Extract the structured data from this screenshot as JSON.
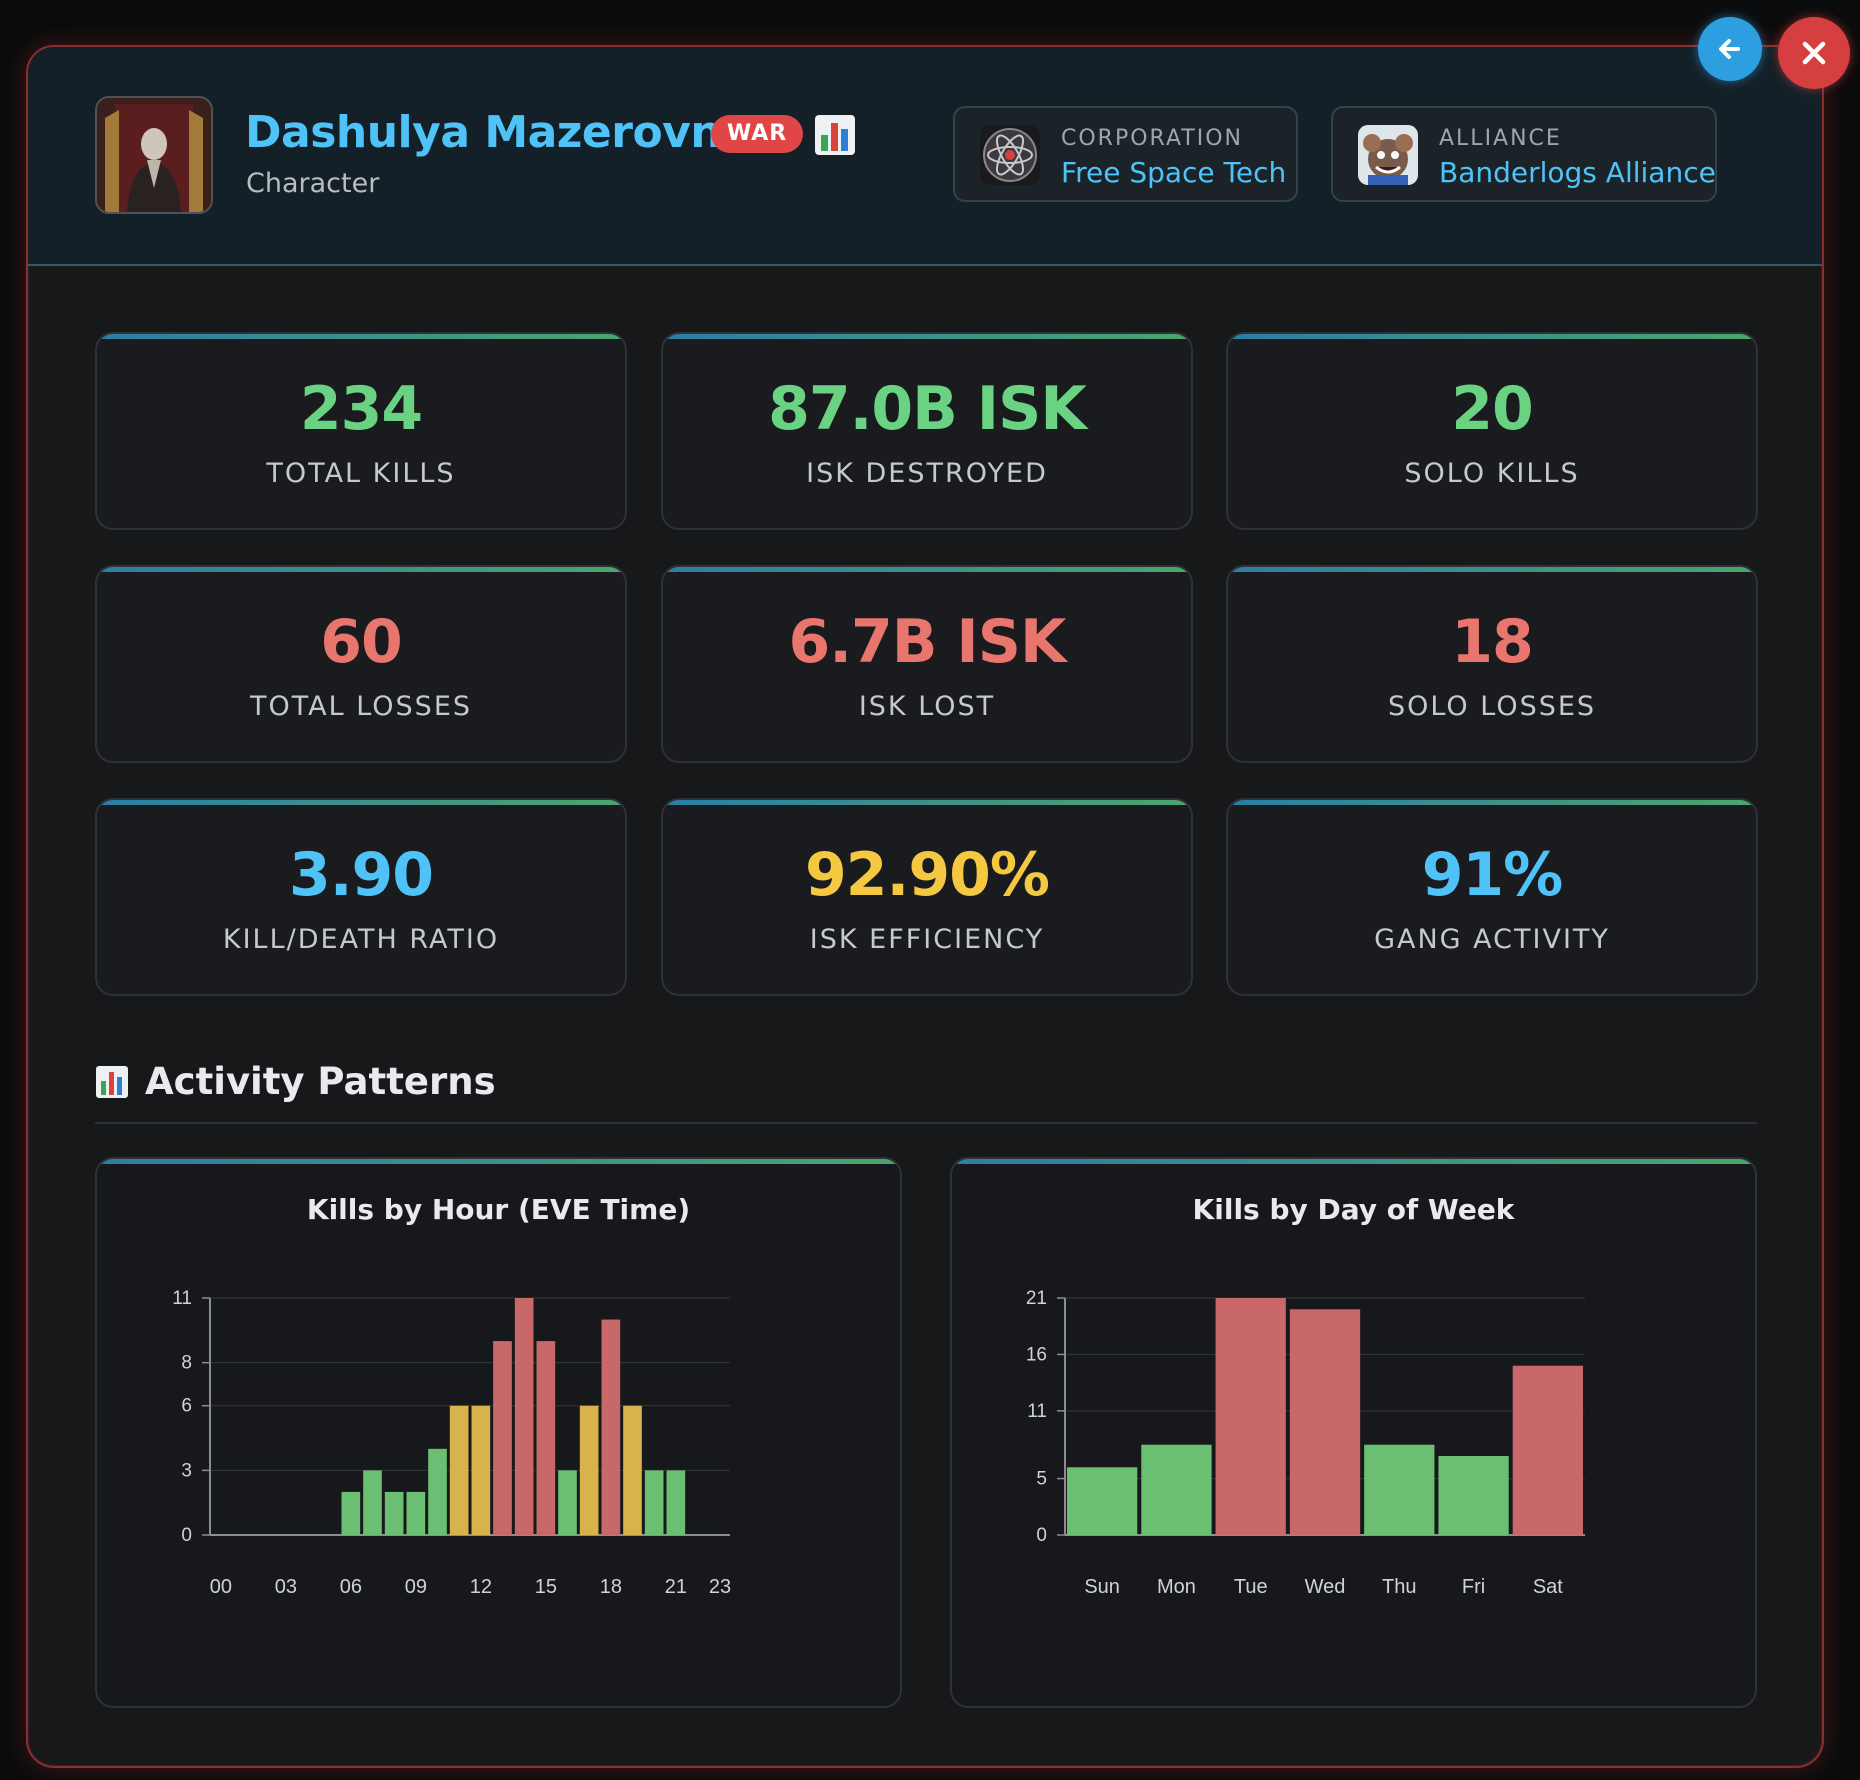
{
  "character": {
    "name": "Dashulya Mazerovna",
    "subtitle": "Character",
    "war_badge": "WAR"
  },
  "corporation": {
    "label": "CORPORATION",
    "name": "Free Space Tech"
  },
  "alliance": {
    "label": "ALLIANCE",
    "name": "Banderlogs Alliance"
  },
  "buttons": {
    "back": "arrow-left-icon",
    "close": "close-icon"
  },
  "stats": [
    {
      "value": "234",
      "label": "TOTAL KILLS",
      "color": "#6ad383"
    },
    {
      "value": "87.0B ISK",
      "label": "ISK DESTROYED",
      "color": "#6ad383"
    },
    {
      "value": "20",
      "label": "SOLO KILLS",
      "color": "#6ad383"
    },
    {
      "value": "60",
      "label": "TOTAL LOSSES",
      "color": "#e8756e"
    },
    {
      "value": "6.7B ISK",
      "label": "ISK LOST",
      "color": "#e8756e"
    },
    {
      "value": "18",
      "label": "SOLO LOSSES",
      "color": "#e8756e"
    },
    {
      "value": "3.90",
      "label": "KILL/DEATH RATIO",
      "color": "#4fc3f7"
    },
    {
      "value": "92.90%",
      "label": "ISK EFFICIENCY",
      "color": "#f5c842"
    },
    {
      "value": "91%",
      "label": "GANG ACTIVITY",
      "color": "#4fc3f7"
    }
  ],
  "section": {
    "title": "Activity Patterns"
  },
  "chart_data": [
    {
      "type": "bar",
      "title": "Kills by Hour (EVE Time)",
      "x": [
        0,
        1,
        2,
        3,
        4,
        5,
        6,
        7,
        8,
        9,
        10,
        11,
        12,
        13,
        14,
        15,
        16,
        17,
        18,
        19,
        20,
        21,
        22,
        23
      ],
      "values": [
        0,
        0,
        0,
        0,
        0,
        0,
        2,
        3,
        2,
        2,
        4,
        6,
        6,
        9,
        11,
        9,
        3,
        6,
        10,
        6,
        3,
        3,
        0,
        0
      ],
      "bar_colors": [
        "#6abf72",
        "#6abf72",
        "#6abf72",
        "#6abf72",
        "#6abf72",
        "#6abf72",
        "#6abf72",
        "#6abf72",
        "#6abf72",
        "#6abf72",
        "#6abf72",
        "#d8b24a",
        "#d8b24a",
        "#c96868",
        "#c96868",
        "#c96868",
        "#6abf72",
        "#d8b24a",
        "#c96868",
        "#d8b24a",
        "#6abf72",
        "#6abf72",
        "#6abf72",
        "#6abf72"
      ],
      "x_ticks": [
        "00",
        "03",
        "06",
        "09",
        "12",
        "15",
        "18",
        "21",
        "23"
      ],
      "y_ticks": [
        "0",
        "3",
        "6",
        "8",
        "11"
      ],
      "ylim": [
        0,
        11
      ],
      "grid": true
    },
    {
      "type": "bar",
      "title": "Kills by Day of Week",
      "categories": [
        "Sun",
        "Mon",
        "Tue",
        "Wed",
        "Thu",
        "Fri",
        "Sat"
      ],
      "values": [
        6,
        8,
        21,
        20,
        8,
        7,
        15
      ],
      "bar_colors": [
        "#6abf72",
        "#6abf72",
        "#c96868",
        "#c96868",
        "#6abf72",
        "#6abf72",
        "#c96868"
      ],
      "y_ticks": [
        "0",
        "5",
        "11",
        "16",
        "21"
      ],
      "ylim": [
        0,
        21
      ],
      "grid": true
    }
  ]
}
